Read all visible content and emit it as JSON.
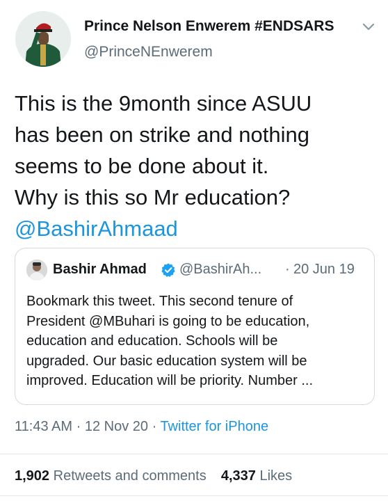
{
  "author": {
    "name": "Prince Nelson Enwerem #ENDSARS",
    "handle": "@PrinceNEnwerem"
  },
  "tweet": {
    "lines": [
      "This is the 9month since ASUU",
      "has been on strike and nothing",
      "seems to be done about it.",
      "Why is this so Mr education?"
    ],
    "mention": "@BashirAhmaad"
  },
  "quoted": {
    "name": "Bashir Ahmad",
    "handle": "@BashirAh...",
    "separator": "·",
    "date": "20 Jun 19",
    "lines": [
      "Bookmark this tweet. This second tenure of",
      "President @MBuhari is going to be education,",
      "education and education. Schools will be",
      "upgraded. Our basic education system will be",
      "improved. Education will be priority. Number ..."
    ]
  },
  "meta": {
    "time": "11:43 AM",
    "separator": "·",
    "date": "12 Nov 20",
    "source": "Twitter for iPhone"
  },
  "stats": {
    "retweets_count": "1,902",
    "retweets_label": "Retweets and comments",
    "likes_count": "4,337",
    "likes_label": "Likes"
  },
  "icons": {
    "menu": "chevron-down-icon",
    "verified": "verified-badge-icon"
  },
  "colors": {
    "link": "#1b95e0",
    "secondary_text": "#5b6b78",
    "verified": "#1da1f2"
  }
}
